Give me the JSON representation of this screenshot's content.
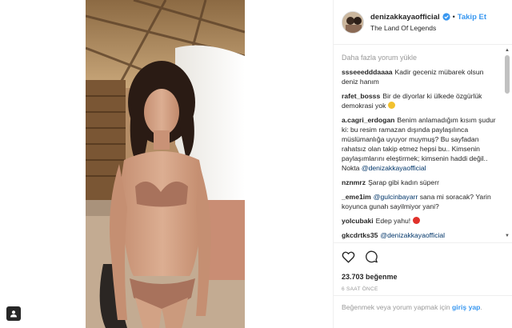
{
  "post": {
    "username": "denizakkayaofficial",
    "follow_separator": "•",
    "follow_label": "Takip Et",
    "location": "The Land Of Legends",
    "load_more": "Daha fazla yorum yükle",
    "likes": "23.703 beğenme",
    "time_ago": "6 SAAT ÖNCE",
    "comment_prompt": "Beğenmek veya yorum yapmak için",
    "login_link": "giriş yap",
    "comment_prompt_end": "."
  },
  "comments": [
    {
      "user": "ssseeedddaaaa",
      "text": "Kadir geceniz mübarek olsun deniz hanım"
    },
    {
      "user": "rafet_bosss",
      "text": "Bir de diyorlar ki ülkede özgürlük demokrasi yok"
    },
    {
      "user": "a.cagri_erdogan",
      "text": "Benim anlamadığım kısım şudur ki: bu resim ramazan dışında paylaşılınca müslümanlığa uyuyor muymuş? Bu sayfadan rahatsız olan takip etmez hepsi bu.. Kimsenin paylaşımlarını eleştirmek; kimsenin haddi değil.. Nokta",
      "mention": "@denizakkayaofficial"
    },
    {
      "user": "nznmrz",
      "text": "Şarap gibi kadın süperr"
    },
    {
      "user": "_eme1im",
      "mention": "@gulcinbayarr",
      "text": "sana mi soracak? Yarin koyunca gunah sayilmiyor yani?"
    },
    {
      "user": "yolcubaki",
      "text": "Edep yahu!"
    },
    {
      "user": "gkcdrtks35",
      "mention": "@denizakkayaofficial"
    }
  ],
  "colors": {
    "accent": "#3897f0",
    "text": "#262626",
    "muted": "#999999",
    "mention": "#003569"
  },
  "icons": [
    "heart-icon",
    "comment-icon",
    "verified-badge-icon",
    "user-tag-icon"
  ]
}
